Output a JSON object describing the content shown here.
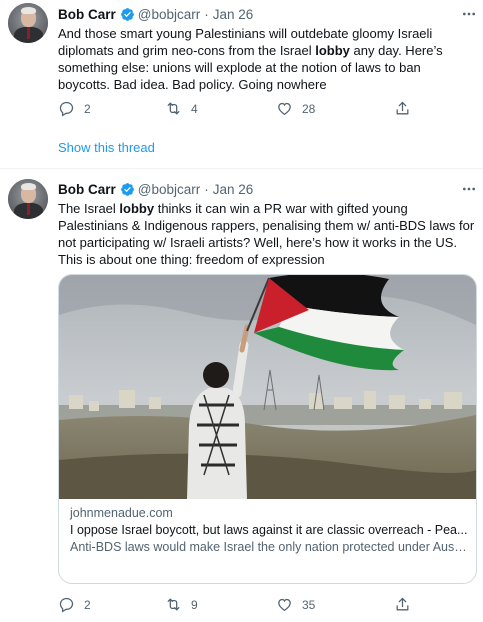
{
  "tweets": [
    {
      "author_name": "Bob Carr",
      "handle": "@bobjcarr",
      "separator": "·",
      "date": "Jan 26",
      "text_before": "And those smart young Palestinians will outdebate gloomy Israeli diplomats and grim neo-cons from the Israel ",
      "text_bold": "lobby",
      "text_after": " any day. Here’s something else: unions will explode at the notion of laws to ban boycotts. Bad idea. Bad policy. Going nowhere",
      "replies": "2",
      "retweets": "4",
      "likes": "28",
      "show_thread": "Show this thread"
    },
    {
      "author_name": "Bob Carr",
      "handle": "@bobjcarr",
      "separator": "·",
      "date": "Jan 26",
      "text_before": "The Israel ",
      "text_bold": "lobby",
      "text_after": " thinks it can win a PR war with gifted young Palestinians & Indigenous rappers, penalising them w/ anti-BDS laws for not participating w/ Israeli artists? Well, here’s how it works in the US. This is about one thing: freedom of expression",
      "replies": "2",
      "retweets": "9",
      "likes": "35",
      "card": {
        "domain": "johnmenadue.com",
        "title": "I oppose Israel boycott, but laws against it are classic overreach - Pea...",
        "description": "Anti-BDS laws would make Israel the only nation protected under Australian statute from this kind of criticism and penalise innocent ..."
      }
    }
  ],
  "icons": {
    "verified": "verified-badge-icon",
    "more": "more-horizontal-icon",
    "reply": "reply-icon",
    "retweet": "retweet-icon",
    "like": "heart-icon",
    "share": "share-icon"
  },
  "colors": {
    "accent": "#1d9bf0",
    "text": "#0f1419",
    "secondary": "#536471",
    "border": "#cfd9de"
  }
}
